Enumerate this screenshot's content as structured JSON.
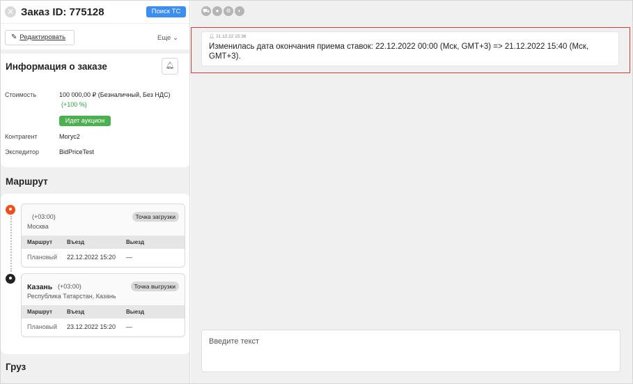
{
  "header": {
    "close_icon": "close-icon",
    "title": "Заказ ID: 775128",
    "search_ts_label": "Поиск ТС"
  },
  "actions": {
    "edit_label": "Редактировать",
    "more_label": "Еще ⌄"
  },
  "info": {
    "title": "Информация о заказе",
    "rows": [
      {
        "label": "Стоимость",
        "value": "100 000,00 ₽ (Безналичный, Без НДС)"
      },
      {
        "label": "Контрагент",
        "value": "Могус2"
      },
      {
        "label": "Экспедитор",
        "value": "BidPriceTest"
      }
    ],
    "markup": "(+100 %)",
    "auction_label": "Идет аукцион"
  },
  "route": {
    "title": "Маршрут",
    "table_headers": [
      "Маршрут",
      "Въезд",
      "Выезд"
    ],
    "stops": [
      {
        "city": "",
        "tz": "(+03:00)",
        "sub": "Москва",
        "badge": "Точка загрузки",
        "row": [
          "Плановый",
          "22.12.2022 15:20",
          "—"
        ]
      },
      {
        "city": "Казань",
        "tz": "(+03:00)",
        "sub": "Республика Татарстан, Казань",
        "badge": "Точка выгрузки",
        "row": [
          "Плановый",
          "23.12.2022 15:20",
          "—"
        ]
      }
    ]
  },
  "cargo": {
    "title": "Груз"
  },
  "feed": {
    "filter_icons": [
      "truck-icon",
      "user-icon",
      "gear-icon",
      "users-icon"
    ],
    "message": {
      "meta": "21.12.22 15:36",
      "text": "Изменилась дата окончания приема ставок: 22.12.2022 00:00 (Мск, GMT+3) => 21.12.2022 15:40 (Мск, GMT+3)."
    }
  },
  "compose": {
    "placeholder": "Введите текст"
  },
  "colors": {
    "accent_blue": "#3d8ef2",
    "auction_green": "#4caf50",
    "pin_orange": "#f04f1d",
    "highlight_red": "#d33a3a"
  }
}
